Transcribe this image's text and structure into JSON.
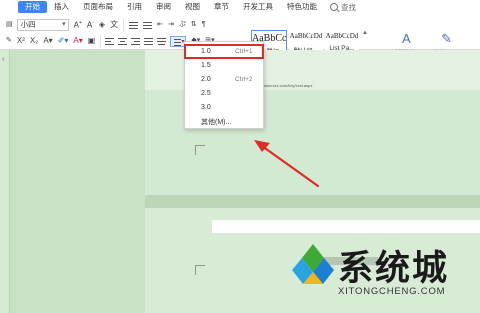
{
  "tabs": [
    "开始",
    "插入",
    "页面布局",
    "引用",
    "审阅",
    "视图",
    "章节",
    "开发工具",
    "特色功能"
  ],
  "search_label": "查找",
  "font": {
    "name": "小四"
  },
  "style_gallery": [
    {
      "sample": "AaBbCcI",
      "name": "正文置行..."
    },
    {
      "sample": "AaBbCcDd",
      "name": "默认段..."
    },
    {
      "sample": "AaBbCcDd",
      "name": "List Pa..."
    }
  ],
  "ribbon_buttons": {
    "new_style": "新样式▾",
    "text_tools": "文字工具▾"
  },
  "line_spacing_menu": {
    "options": [
      {
        "value": "1.0",
        "shortcut": "Ctrl+1"
      },
      {
        "value": "1.5",
        "shortcut": ""
      },
      {
        "value": "2.0",
        "shortcut": "Ctrl+2"
      },
      {
        "value": "2.5",
        "shortcut": ""
      },
      {
        "value": "3.0",
        "shortcut": ""
      },
      {
        "value": "其他(M)...",
        "shortcut": ""
      }
    ],
    "highlighted": "1.0"
  },
  "document": {
    "tiny_text": "www.xxx.com/key/xxxt.aspx"
  },
  "watermark": {
    "title": "系统城",
    "url": "XITONGCHENG.COM"
  },
  "colors": {
    "accent": "#3c86f1",
    "highlight_box": "#e02a24",
    "doc_bg": "#c9e2c6"
  }
}
